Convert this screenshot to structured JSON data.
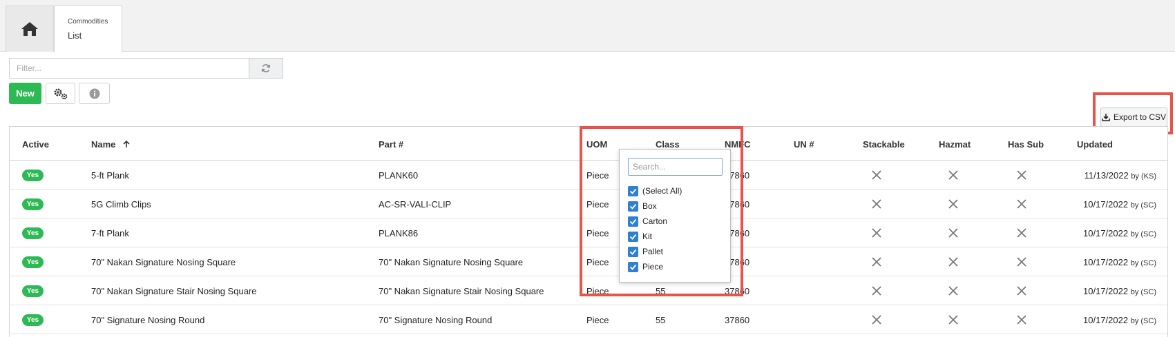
{
  "tabs": {
    "home_icon": "home-icon",
    "list_tab": {
      "subtitle": "Commodities",
      "title": "List"
    }
  },
  "toolbar": {
    "filter_placeholder": "Filter...",
    "refresh_icon": "refresh-icon",
    "new_label": "New",
    "settings_icon": "gears-icon",
    "info_icon": "info-icon",
    "export_label": "Export to CSV",
    "export_icon": "download-icon"
  },
  "table": {
    "columns": [
      "Active",
      "Name",
      "Part #",
      "UOM",
      "Class",
      "NMFC",
      "UN #",
      "Stackable",
      "Hazmat",
      "Has Sub",
      "Updated"
    ],
    "sort_column": "Name",
    "sort_direction": "ascending",
    "rows": [
      {
        "active": "Yes",
        "name": "5-ft Plank",
        "part": "PLANK60",
        "uom": "Piece",
        "class": "",
        "nmfc": "37860",
        "un": "",
        "updated": "11/13/2022",
        "by": "by (KS)"
      },
      {
        "active": "Yes",
        "name": "5G Climb Clips",
        "part": "AC-SR-VALI-CLIP",
        "uom": "Piece",
        "class": "",
        "nmfc": "37860",
        "un": "",
        "updated": "10/17/2022",
        "by": "by (SC)"
      },
      {
        "active": "Yes",
        "name": "7-ft Plank",
        "part": "PLANK86",
        "uom": "Piece",
        "class": "",
        "nmfc": "37860",
        "un": "",
        "updated": "10/17/2022",
        "by": "by (SC)"
      },
      {
        "active": "Yes",
        "name": "70\" Nakan Signature Nosing Square",
        "part": "70\" Nakan Signature Nosing Square",
        "uom": "Piece",
        "class": "",
        "nmfc": "37860",
        "un": "",
        "updated": "10/17/2022",
        "by": "by (SC)"
      },
      {
        "active": "Yes",
        "name": "70\" Nakan Signature Stair Nosing Square",
        "part": "70\" Nakan Signature Stair Nosing Square",
        "uom": "Piece",
        "class": "55",
        "nmfc": "37860",
        "un": "",
        "updated": "10/17/2022",
        "by": "by (SC)"
      },
      {
        "active": "Yes",
        "name": "70\" Signature Nosing Round",
        "part": "70\" Signature Nosing Round",
        "uom": "Piece",
        "class": "55",
        "nmfc": "37860",
        "un": "",
        "updated": "10/17/2022",
        "by": "by (SC)"
      }
    ]
  },
  "uom_filter": {
    "search_placeholder": "Search...",
    "options": [
      {
        "label": "(Select All)",
        "checked": true
      },
      {
        "label": "Box",
        "checked": true
      },
      {
        "label": "Carton",
        "checked": true
      },
      {
        "label": "Kit",
        "checked": true
      },
      {
        "label": "Pallet",
        "checked": true
      },
      {
        "label": "Piece",
        "checked": true
      }
    ]
  },
  "colors": {
    "accent_green": "#2dba55",
    "checkbox_blue": "#2f7fd3",
    "highlight_red": "#e8534a"
  }
}
